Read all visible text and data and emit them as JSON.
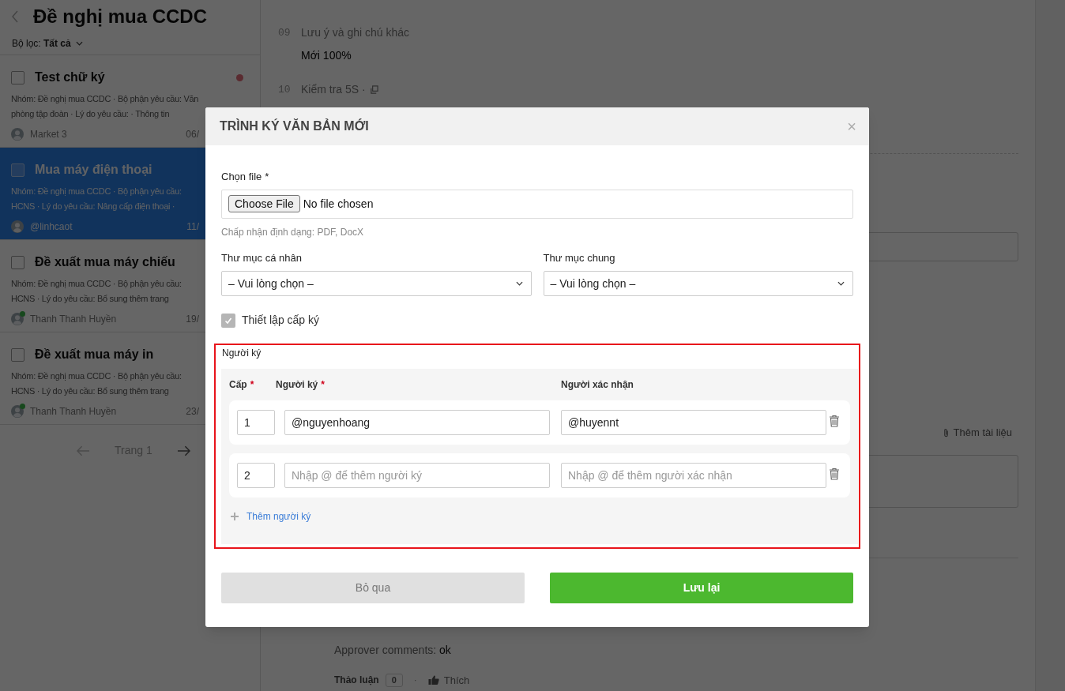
{
  "sidebar": {
    "title": "Đề nghị mua CCDC",
    "filter": "Bộ lọc: **Tất cả**",
    "items": [
      {
        "title": "Test chữ ký",
        "selected": false,
        "checked": false,
        "unread": true,
        "online": false,
        "lines": [
          "Nhóm: Đề nghị mua CCDC · Bộ phận yêu cầu: Văn",
          "phòng tập đoàn · Lý do yêu cầu: · Thông tin"
        ],
        "author": "Market 3",
        "date": "06/"
      },
      {
        "title": "Mua máy điện thoại",
        "selected": true,
        "checked": false,
        "unread": false,
        "online": false,
        "lines": [
          "Nhóm: Đề nghị mua CCDC · Bộ phận yêu cầu:",
          "HCNS · Lý do yêu cầu: Nâng cấp điện thoại ·"
        ],
        "author": "@linhcaot",
        "date": "11/"
      },
      {
        "title": "Đề xuất mua máy chiếu",
        "selected": false,
        "checked": false,
        "unread": false,
        "online": true,
        "lines": [
          "Nhóm: Đề nghị mua CCDC · Bộ phận yêu cầu:",
          "HCNS · Lý do yêu cầu: Bổ sung thêm trang"
        ],
        "author": "Thanh Thanh Huyền",
        "date": "19/"
      },
      {
        "title": "Đề xuất mua máy in",
        "selected": false,
        "checked": false,
        "unread": false,
        "online": true,
        "lines": [
          "Nhóm: Đề nghị mua CCDC · Bộ phận yêu cầu:",
          "HCNS · Lý do yêu cầu: Bổ sung thêm trang"
        ],
        "author": "Thanh Thanh Huyền",
        "date": "23/"
      }
    ],
    "page": "Trang 1"
  },
  "main": {
    "fields": [
      {
        "number": "09",
        "label": "Lưu ý và ghi chú khác",
        "value": "Mới 100%"
      },
      {
        "number": "10",
        "label": "Kiểm tra 5S ·"
      }
    ],
    "attach": "Thêm tài liệu",
    "approver_comment": {
      "label": "Approver comments:",
      "value": "ok"
    },
    "discussion": {
      "label": "Thảo luận",
      "count": "0",
      "separator": "·",
      "like": "Thích"
    }
  },
  "modal": {
    "title": "TRÌNH KÝ VĂN BẢN MỚI",
    "close": "×",
    "file": {
      "label": "Chọn file",
      "required_mark": "*",
      "button": "Choose File",
      "status": "No file chosen",
      "hint": "Chấp nhận định dạng: PDF, DocX"
    },
    "selects": [
      {
        "label": "Thư mục cá nhân",
        "value": "– Vui lòng chọn –"
      },
      {
        "label": "Thư mục chung",
        "value": "– Vui lòng chọn –"
      }
    ],
    "levels_checkbox": {
      "label": "Thiết lập cấp ký",
      "checked": true,
      "disabled": true
    },
    "signers": {
      "title": "Người ký",
      "highlighted": true,
      "columns": [
        {
          "label": "Cấp",
          "required_mark": "*"
        },
        {
          "label": "Người ký",
          "required_mark": "*"
        },
        {
          "label": "Người xác nhận"
        }
      ],
      "rows": [
        {
          "level": "1",
          "signer": {
            "value": "@nguyenhoang"
          },
          "confirmer": {
            "value": "@huyennt"
          }
        },
        {
          "level": "2",
          "signer": {
            "placeholder": "Nhập @ để thêm người ký"
          },
          "confirmer": {
            "placeholder": "Nhập @ để thêm người xác nhận"
          }
        }
      ],
      "add": "Thêm người ký"
    },
    "buttons": [
      {
        "label": "Bỏ qua",
        "kind": "secondary"
      },
      {
        "label": "Lưu lại",
        "kind": "primary"
      }
    ]
  }
}
